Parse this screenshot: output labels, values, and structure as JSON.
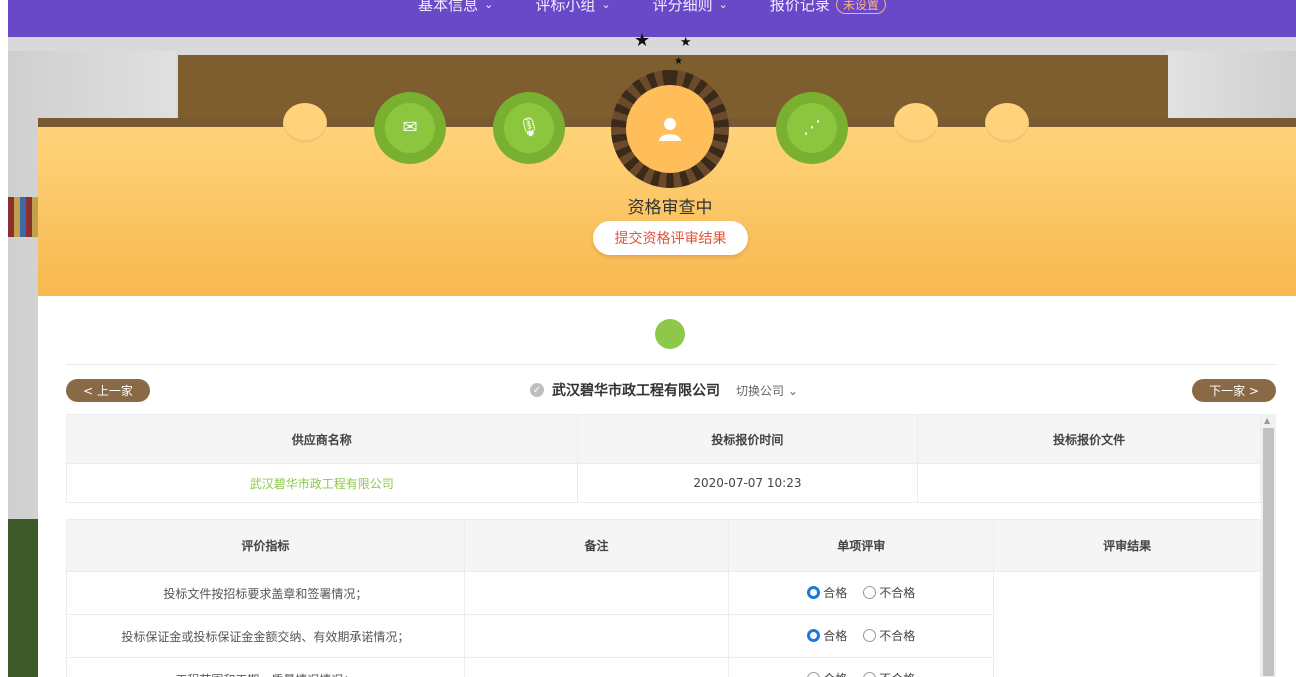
{
  "topnav": {
    "items": [
      {
        "label": "基本信息"
      },
      {
        "label": "评标小组"
      },
      {
        "label": "评分细则"
      },
      {
        "label": "报价记录"
      }
    ],
    "badge": "未设置"
  },
  "stage": {
    "title": "资格审查中",
    "submit_label": "提交资格评审结果"
  },
  "nav": {
    "prev_label": "< 上一家",
    "next_label": "下一家 >",
    "company_name": "武汉碧华市政工程有限公司",
    "switch_label": "切换公司"
  },
  "supplier_table": {
    "headers": [
      "供应商名称",
      "投标报价时间",
      "投标报价文件"
    ],
    "row": {
      "supplier": "武汉碧华市政工程有限公司",
      "time": "2020-07-07 10:23",
      "file": ""
    }
  },
  "review_table": {
    "headers": [
      "评价指标",
      "备注",
      "单项评审",
      "评审结果"
    ],
    "rows": [
      {
        "indicator": "投标文件按招标要求盖章和签署情况；",
        "note": "",
        "selected": "合格"
      },
      {
        "indicator": "投标保证金或投标保证金金额交纳、有效期承诺情况；",
        "note": "",
        "selected": "合格"
      },
      {
        "indicator": "工程范围和工期、质量情况情况；",
        "note": "",
        "selected": ""
      }
    ],
    "option_pass": "合格",
    "option_fail": "不合格"
  },
  "colors": {
    "nav_bg": "#6a49c8",
    "accent_green": "#8dc84a",
    "stage_orange": "#f7b84e",
    "pill_brown": "#8a6a46"
  }
}
